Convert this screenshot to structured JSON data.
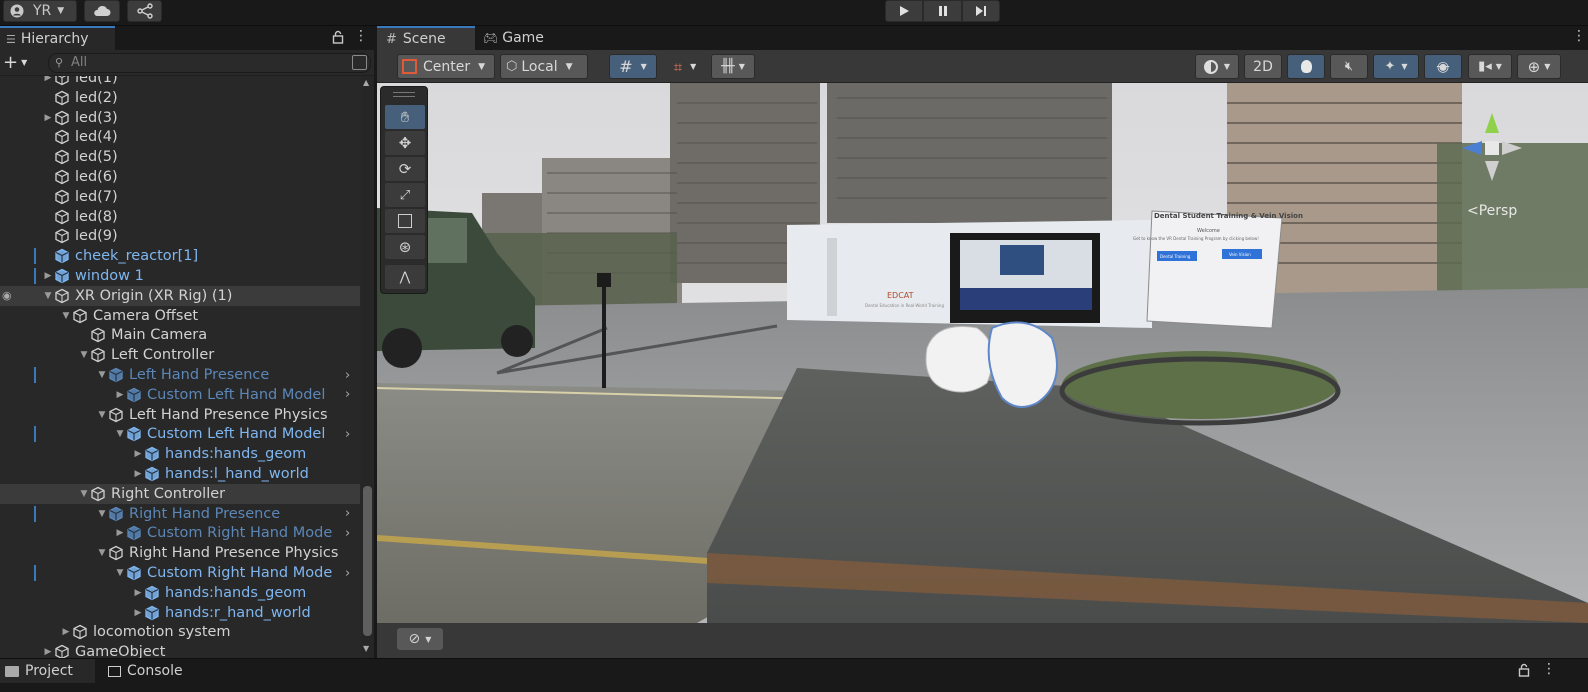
{
  "topbar": {
    "account": "YR",
    "play_icon": "play-icon",
    "pause_icon": "pause-icon",
    "step_icon": "step-icon"
  },
  "hierarchy": {
    "tab": "Hierarchy",
    "search_placeholder": "All",
    "items": [
      {
        "label": "led(1)",
        "depth": 2,
        "arrow": true,
        "style": "normal"
      },
      {
        "label": "led(2)",
        "depth": 2,
        "arrow": false,
        "style": "normal"
      },
      {
        "label": "led(3)",
        "depth": 2,
        "arrow": true,
        "style": "normal"
      },
      {
        "label": "led(4)",
        "depth": 2,
        "arrow": false,
        "style": "normal"
      },
      {
        "label": "led(5)",
        "depth": 2,
        "arrow": false,
        "style": "normal"
      },
      {
        "label": "led(6)",
        "depth": 2,
        "arrow": false,
        "style": "normal"
      },
      {
        "label": "led(7)",
        "depth": 2,
        "arrow": false,
        "style": "normal"
      },
      {
        "label": "led(8)",
        "depth": 2,
        "arrow": false,
        "style": "normal"
      },
      {
        "label": "led(9)",
        "depth": 2,
        "arrow": false,
        "style": "normal"
      },
      {
        "label": "cheek_reactor[1]",
        "depth": 2,
        "arrow": false,
        "style": "prefab",
        "mark": true
      },
      {
        "label": "window 1",
        "depth": 2,
        "arrow": true,
        "style": "prefab",
        "mark": true
      },
      {
        "label": "XR Origin (XR Rig) (1)",
        "depth": 2,
        "arrow": true,
        "open": true,
        "style": "normal",
        "selected": true,
        "eye": true
      },
      {
        "label": "Camera Offset",
        "depth": 3,
        "arrow": true,
        "open": true,
        "style": "normal"
      },
      {
        "label": "Main Camera",
        "depth": 4,
        "arrow": false,
        "style": "normal"
      },
      {
        "label": "Left Controller",
        "depth": 4,
        "arrow": true,
        "open": true,
        "style": "normal"
      },
      {
        "label": "Left Hand Presence",
        "depth": 5,
        "arrow": true,
        "open": true,
        "style": "dim",
        "mark": true,
        "chev": true
      },
      {
        "label": "Custom Left Hand Model",
        "depth": 6,
        "arrow": true,
        "style": "dim",
        "chev": true
      },
      {
        "label": "Left Hand Presence Physics",
        "depth": 5,
        "arrow": true,
        "open": true,
        "style": "normal"
      },
      {
        "label": "Custom Left Hand Model",
        "depth": 6,
        "arrow": true,
        "open": true,
        "style": "prefab",
        "mark": true,
        "chev": true
      },
      {
        "label": "hands:hands_geom",
        "depth": 7,
        "arrow": true,
        "style": "prefab"
      },
      {
        "label": "hands:l_hand_world",
        "depth": 7,
        "arrow": true,
        "style": "prefab"
      },
      {
        "label": "Right Controller",
        "depth": 4,
        "arrow": true,
        "open": true,
        "style": "normal",
        "selected": true
      },
      {
        "label": "Right Hand Presence",
        "depth": 5,
        "arrow": true,
        "open": true,
        "style": "dim",
        "mark": true,
        "chev": true
      },
      {
        "label": "Custom Right Hand Mode",
        "depth": 6,
        "arrow": true,
        "style": "dim",
        "chev": true
      },
      {
        "label": "Right Hand Presence Physics",
        "depth": 5,
        "arrow": true,
        "open": true,
        "style": "normal"
      },
      {
        "label": "Custom Right Hand Mode",
        "depth": 6,
        "arrow": true,
        "open": true,
        "style": "prefab",
        "mark": true,
        "chev": true
      },
      {
        "label": "hands:hands_geom",
        "depth": 7,
        "arrow": true,
        "style": "prefab"
      },
      {
        "label": "hands:r_hand_world",
        "depth": 7,
        "arrow": true,
        "style": "prefab"
      },
      {
        "label": "locomotion system",
        "depth": 3,
        "arrow": true,
        "style": "normal"
      },
      {
        "label": "GameObject",
        "depth": 2,
        "arrow": true,
        "style": "normal"
      }
    ]
  },
  "scene": {
    "tabs": [
      "Scene",
      "Game"
    ],
    "pivot": "Center",
    "space": "Local",
    "mode_2d": "2D",
    "persp": "<Persp",
    "board_title": "Dental Student Training & Vein Vision",
    "board_welcome": "Welcome",
    "board_text": "Get to know the VR Dental Training Program by clicking below!",
    "board_btn1": "Dental Training",
    "board_btn2": "Vein Vision",
    "wall_logo": "EDCAT",
    "wall_sub": "Dental Education in Real-World Training"
  },
  "bottom": {
    "project": "Project",
    "console": "Console"
  }
}
